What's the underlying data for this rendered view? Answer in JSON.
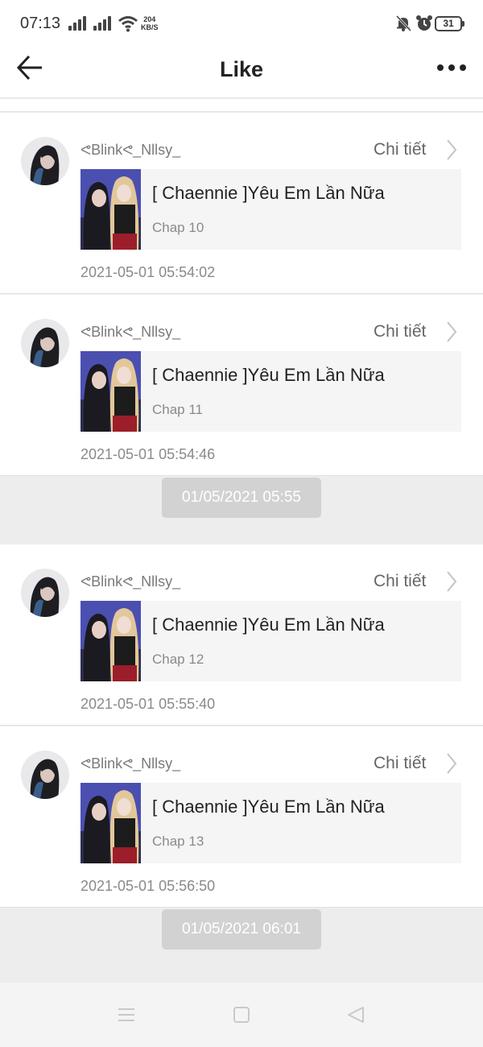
{
  "status_bar": {
    "time": "07:13",
    "net_speed_value": "204",
    "net_speed_unit": "KB/S",
    "battery": "31"
  },
  "header": {
    "title": "Like"
  },
  "cards": [
    {
      "username": "ᕙBlinkᕙ_Nllsy_",
      "detail_label": "Chi tiết",
      "story_title": "[ Chaennie ]Yêu Em Lần Nữa",
      "chapter": "Chap 10",
      "timestamp": "2021-05-01 05:54:02"
    },
    {
      "username": "ᕙBlinkᕙ_Nllsy_",
      "detail_label": "Chi tiết",
      "story_title": "[ Chaennie ]Yêu Em Lần Nữa",
      "chapter": "Chap 11",
      "timestamp": "2021-05-01 05:54:46"
    },
    {
      "username": "ᕙBlinkᕙ_Nllsy_",
      "detail_label": "Chi tiết",
      "story_title": "[ Chaennie ]Yêu Em Lần Nữa",
      "chapter": "Chap 12",
      "timestamp": "2021-05-01 05:55:40"
    },
    {
      "username": "ᕙBlinkᕙ_Nllsy_",
      "detail_label": "Chi tiết",
      "story_title": "[ Chaennie ]Yêu Em Lần Nữa",
      "chapter": "Chap 13",
      "timestamp": "2021-05-01 05:56:50"
    }
  ],
  "date_separators": [
    "01/05/2021 05:55",
    "01/05/2021 06:01"
  ],
  "icons": {
    "back": "arrow-left-icon",
    "more": "more-dots-icon",
    "detail": "chevron-right-icon",
    "nav": [
      "menu-icon",
      "home-square-icon",
      "back-triangle-icon"
    ]
  },
  "colors": {
    "background": "#ededed",
    "card": "#ffffff",
    "chapter_box": "#f5f5f5",
    "separator": "#d2d2d2"
  }
}
